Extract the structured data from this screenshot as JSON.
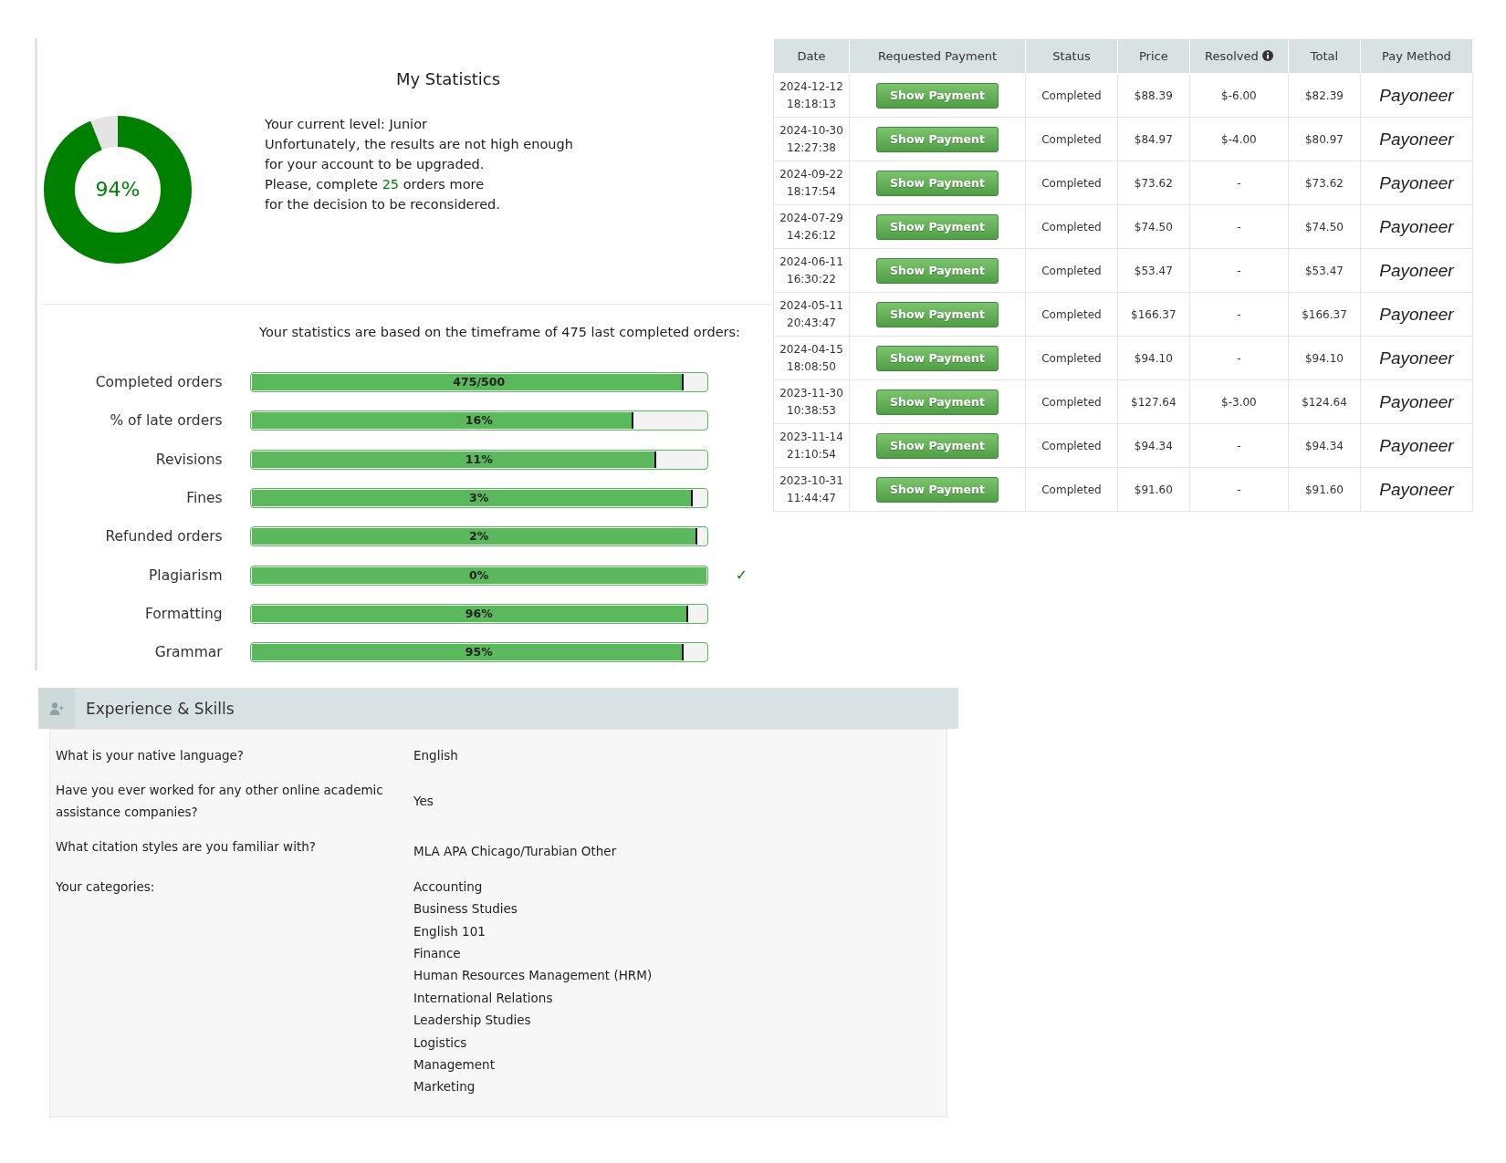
{
  "statistics": {
    "title": "My Statistics",
    "donut": {
      "label": "94%",
      "level": 0.94
    },
    "message": [
      {
        "text": "Your current level: Junior"
      },
      {
        "text": "Unfortunately, the results are not high enough"
      },
      {
        "text": "for your account to be upgraded."
      },
      {
        "text": "Please, complete ",
        "highlight": "25",
        "after": " orders more"
      },
      {
        "text": "for the decision to be reconsidered."
      }
    ],
    "timeframe_note": "Your statistics are based on the timeframe of 475 last completed orders:",
    "bars": [
      {
        "label": "Completed orders",
        "reading": "475/500",
        "level": 0.95
      },
      {
        "label": "% of late orders",
        "reading": "16%",
        "level": 0.84
      },
      {
        "label": "Revisions",
        "reading": "11%",
        "level": 0.89
      },
      {
        "label": "Fines",
        "reading": "3%",
        "level": 0.97
      },
      {
        "label": "Refunded orders",
        "reading": "2%",
        "level": 0.98
      },
      {
        "label": "Plagiarism",
        "reading": "0%",
        "level": 1.0,
        "check_mark": "✓"
      },
      {
        "label": "Formatting",
        "reading": "96%",
        "level": 0.96
      },
      {
        "label": "Grammar",
        "reading": "95%",
        "level": 0.95
      }
    ]
  },
  "payments": {
    "columns": [
      {
        "label": "Date"
      },
      {
        "label": "Requested Payment"
      },
      {
        "label": "Status"
      },
      {
        "label": "Price"
      },
      {
        "label": "Resolved",
        "info": true
      },
      {
        "label": "Total"
      },
      {
        "label": "Pay Method"
      }
    ],
    "rows": [
      {
        "date": "2024-12-12",
        "time": "18:18:13",
        "button": "Show Payment",
        "status": "Completed",
        "price": "$88.39",
        "resolved": "$-6.00",
        "total": "$82.39",
        "pay_method": "Payoneer"
      },
      {
        "date": "2024-10-30",
        "time": "12:27:38",
        "button": "Show Payment",
        "status": "Completed",
        "price": "$84.97",
        "resolved": "$-4.00",
        "total": "$80.97",
        "pay_method": "Payoneer"
      },
      {
        "date": "2024-09-22",
        "time": "18:17:54",
        "button": "Show Payment",
        "status": "Completed",
        "price": "$73.62",
        "resolved": "-",
        "total": "$73.62",
        "pay_method": "Payoneer"
      },
      {
        "date": "2024-07-29",
        "time": "14:26:12",
        "button": "Show Payment",
        "status": "Completed",
        "price": "$74.50",
        "resolved": "-",
        "total": "$74.50",
        "pay_method": "Payoneer"
      },
      {
        "date": "2024-06-11",
        "time": "16:30:22",
        "button": "Show Payment",
        "status": "Completed",
        "price": "$53.47",
        "resolved": "-",
        "total": "$53.47",
        "pay_method": "Payoneer"
      },
      {
        "date": "2024-05-11",
        "time": "20:43:47",
        "button": "Show Payment",
        "status": "Completed",
        "price": "$166.37",
        "resolved": "-",
        "total": "$166.37",
        "pay_method": "Payoneer"
      },
      {
        "date": "2024-04-15",
        "time": "18:08:50",
        "button": "Show Payment",
        "status": "Completed",
        "price": "$94.10",
        "resolved": "-",
        "total": "$94.10",
        "pay_method": "Payoneer"
      },
      {
        "date": "2023-11-30",
        "time": "10:38:53",
        "button": "Show Payment",
        "status": "Completed",
        "price": "$127.64",
        "resolved": "$-3.00",
        "total": "$124.64",
        "pay_method": "Payoneer"
      },
      {
        "date": "2023-11-14",
        "time": "21:10:54",
        "button": "Show Payment",
        "status": "Completed",
        "price": "$94.34",
        "resolved": "-",
        "total": "$94.34",
        "pay_method": "Payoneer"
      },
      {
        "date": "2023-10-31",
        "time": "11:44:47",
        "button": "Show Payment",
        "status": "Completed",
        "price": "$91.60",
        "resolved": "-",
        "total": "$91.60",
        "pay_method": "Payoneer"
      }
    ]
  },
  "experience": {
    "title": "Experience & Skills",
    "items": [
      {
        "question": "What is your native language?",
        "answers": [
          "English"
        ]
      },
      {
        "question": "Have you ever worked for any other online academic assistance companies?",
        "answers": [
          "Yes"
        ]
      },
      {
        "question": "What citation styles are you familiar with?",
        "answers": [
          "MLA APA Chicago/Turabian Other"
        ]
      },
      {
        "question": "Your categories:",
        "answers": [
          "Accounting",
          "Business Studies",
          "English 101",
          "Finance",
          "Human Resources Management (HRM)",
          "International Relations",
          "Leadership Studies",
          "Logistics",
          "Management",
          "Marketing"
        ]
      }
    ]
  }
}
